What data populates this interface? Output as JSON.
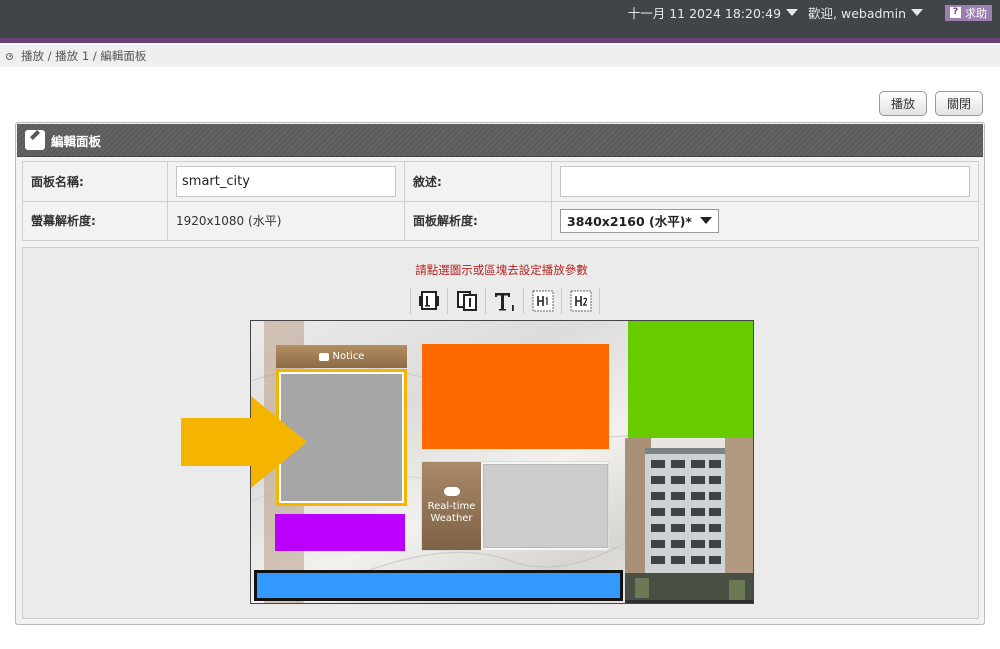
{
  "header": {
    "datetime": "十一月 11 2024 18:20:49",
    "welcome": "歡迎, webadmin",
    "help_label": "求助"
  },
  "breadcrumb": "播放 / 播放 1 / 編輯面板",
  "actions": {
    "play_label": "播放",
    "close_label": "關閉"
  },
  "panel": {
    "title": "編輯面板",
    "name_label": "面板名稱:",
    "name_value": "smart_city",
    "desc_label": "敘述:",
    "desc_value": "",
    "screen_res_label": "螢幕解析度:",
    "screen_res_value": "1920x1080 (水平)",
    "panel_res_label": "面板解析度:",
    "panel_res_value": "3840x2160 (水平)*"
  },
  "editor": {
    "hint": "請點選圖示或區塊去設定播放參數",
    "tools": [
      "single-frame-icon",
      "multi-frame-icon",
      "text-icon",
      "html1-icon",
      "html2-icon"
    ],
    "canvas": {
      "notice_label": "Notice",
      "weather_label_1": "Real-time",
      "weather_label_2": "Weather"
    }
  },
  "colors": {
    "topbar": "#404549",
    "accent": "#69407a",
    "orange_zone": "#ff6a00",
    "green_zone": "#66cc00",
    "purple_zone": "#bb00ff",
    "blue_zone": "#3399ff",
    "selected_zone": "#a6a6a6",
    "selection_border": "#f5b400",
    "arrow": "#f5b400"
  }
}
